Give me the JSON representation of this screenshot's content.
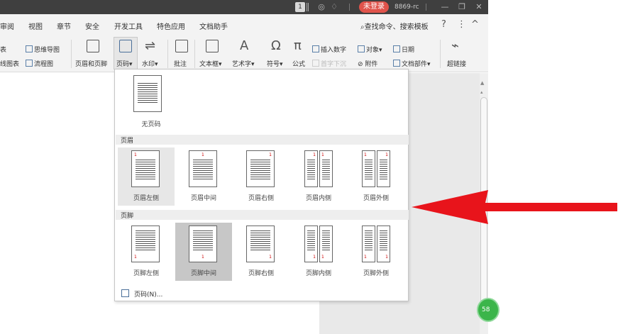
{
  "titlebar": {
    "badge": "1",
    "login": "未登录",
    "user": "8869-rc",
    "icons": [
      "skin-icon",
      "bell-icon",
      "minimize-icon",
      "restore-icon",
      "close-icon"
    ]
  },
  "menu": {
    "tabs": [
      "审阅",
      "视图",
      "章节",
      "安全",
      "开发工具",
      "特色应用",
      "文档助手"
    ],
    "search": "查找命令、搜索模板",
    "help": "?",
    "more": "⋮",
    "collapse": "^"
  },
  "ribbon": {
    "partial_table": "表",
    "partial_chart": "线图表",
    "mindmap": "思维导图",
    "flowchart": "流程图",
    "header_footer": "页眉和页脚",
    "page_number": "页码",
    "watermark": "水印",
    "comment": "批注",
    "textbox": "文本框",
    "wordart": "艺术字",
    "symbol": "符号",
    "formula": "公式",
    "insert_number": "插入数字",
    "drop_cap": "首字下沉",
    "object": "对象",
    "attachment": "附件",
    "date": "日期",
    "doc_parts": "文档部件",
    "hyperlink": "超链接",
    "dropdown_caret": "▾"
  },
  "dropdown": {
    "none_label": "无页码",
    "header_section": "页眉",
    "footer_section": "页脚",
    "header_options": [
      "页眉左侧",
      "页眉中间",
      "页眉右侧",
      "页眉内侧",
      "页眉外侧"
    ],
    "footer_options": [
      "页脚左侧",
      "页脚中间",
      "页脚右侧",
      "页脚内侧",
      "页脚外侧"
    ],
    "page_number_sample": "1",
    "footer_action": "页码(N)..."
  },
  "side": {
    "badge": "58"
  },
  "colors": {
    "accent_red": "#e8141b",
    "login_badge": "#e0534b",
    "green_button": "#3bb54a",
    "titlebar": "#3f3f3f"
  }
}
